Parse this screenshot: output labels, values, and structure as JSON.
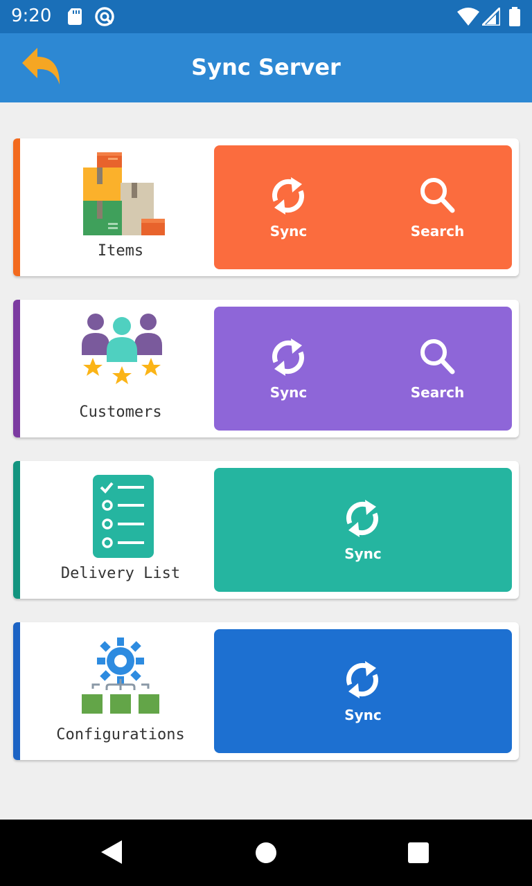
{
  "status_bar": {
    "time": "9:20"
  },
  "app_bar": {
    "title": "Sync Server"
  },
  "colors": {
    "items": "#fb6c3e",
    "customers": "#8e66d8",
    "delivery": "#25b5a0",
    "configurations": "#1d70d1"
  },
  "cards": [
    {
      "label": "Items",
      "buttons": [
        "Sync",
        "Search"
      ]
    },
    {
      "label": "Customers",
      "buttons": [
        "Sync",
        "Search"
      ]
    },
    {
      "label": "Delivery List",
      "buttons": [
        "Sync"
      ]
    },
    {
      "label": "Configurations",
      "buttons": [
        "Sync"
      ]
    }
  ]
}
